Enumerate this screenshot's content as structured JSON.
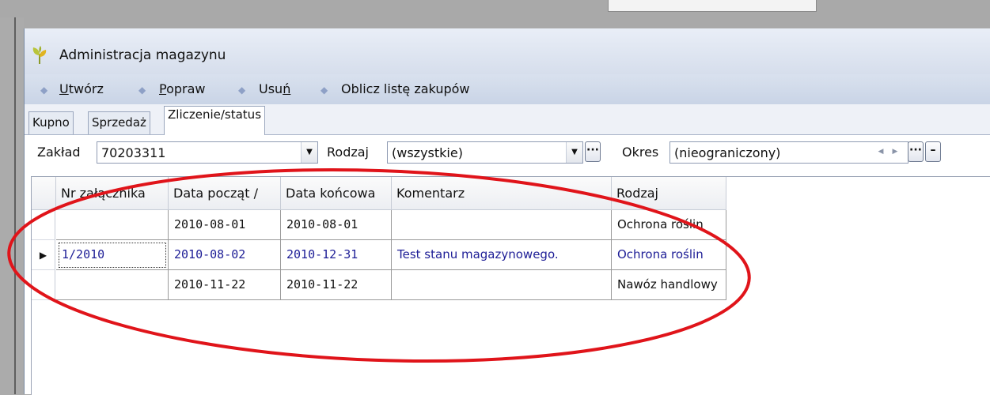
{
  "window": {
    "title": "Administracja magazynu"
  },
  "toolbar": {
    "create": "Utwórz",
    "create_u": "U",
    "create_rest": "twórz",
    "edit_u": "P",
    "edit_rest": "opraw",
    "delete_pre": "Usu",
    "delete_u": "ń",
    "calc": "Oblicz listę zakupów"
  },
  "tabs": [
    {
      "label": "Kupno",
      "active": false
    },
    {
      "label": "Sprzedaż",
      "active": false
    },
    {
      "label": "Zliczenie/status",
      "active": true
    }
  ],
  "filters": {
    "zaklad_label": "Zakład",
    "zaklad_value": "70203311",
    "rodzaj_label": "Rodzaj",
    "rodzaj_value": "(wszystkie)",
    "okres_label": "Okres",
    "okres_value": "(nieograniczony)"
  },
  "grid": {
    "headers": [
      "Nr załącznika",
      "Data począt /",
      "Data końcowa",
      "Komentarz",
      "Rodzaj"
    ],
    "rows": [
      {
        "nr": "",
        "start": "2010-08-01",
        "end": "2010-08-01",
        "comment": "",
        "type": "Ochrona roślin",
        "selected": false
      },
      {
        "nr": "1/2010",
        "start": "2010-08-02",
        "end": "2010-12-31",
        "comment": "Test stanu magazynowego.",
        "type": "Ochrona roślin",
        "selected": true
      },
      {
        "nr": "",
        "start": "2010-11-22",
        "end": "2010-11-22",
        "comment": "",
        "type": "Nawóz handlowy",
        "selected": false
      }
    ]
  },
  "colors": {
    "annotation": "#e0141a",
    "selected_text": "#1d1d96"
  }
}
